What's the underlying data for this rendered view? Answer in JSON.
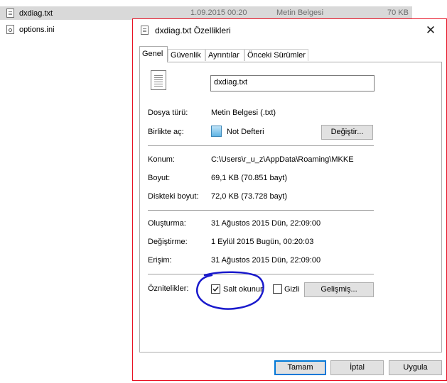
{
  "explorer": {
    "files": [
      {
        "name": "dxdiag.txt",
        "date": "1.09.2015 00:20",
        "type": "Metin Belgesi",
        "size": "70 KB",
        "icon": "text-file-icon"
      },
      {
        "name": "options.ini",
        "date": "",
        "type": "",
        "size": "",
        "icon": "settings-file-icon"
      }
    ]
  },
  "dialog": {
    "title": "dxdiag.txt Özellikleri",
    "close_label": "✕",
    "tabs": [
      "Genel",
      "Güvenlik",
      "Ayrıntılar",
      "Önceki Sürümler"
    ],
    "active_tab": "Genel",
    "file_name": "dxdiag.txt",
    "labels": {
      "file_type": "Dosya türü:",
      "opens_with": "Birlikte aç:",
      "location": "Konum:",
      "size": "Boyut:",
      "size_on_disk": "Diskteki boyut:",
      "created": "Oluşturma:",
      "modified": "Değiştirme:",
      "accessed": "Erişim:",
      "attributes": "Öznitelikler:"
    },
    "values": {
      "file_type": "Metin Belgesi (.txt)",
      "opens_with": "Not Defteri",
      "location": "C:\\Users\\r_u_z\\AppData\\Roaming\\MKKE",
      "size": "69,1 KB (70.851 bayt)",
      "size_on_disk": "72,0 KB (73.728 bayt)",
      "created": "31 Ağustos 2015 Dün, 22:09:00",
      "modified": "1 Eylül 2015 Bugün, 00:20:03",
      "accessed": "31 Ağustos 2015 Dün, 22:09:00"
    },
    "change_button": "Değiştir...",
    "attributes": {
      "readonly_label": "Salt okunur",
      "readonly_checked": true,
      "hidden_label": "Gizli",
      "hidden_checked": false,
      "advanced_button": "Gelişmiş..."
    },
    "buttons": {
      "ok": "Tamam",
      "cancel": "İptal",
      "apply": "Uygula"
    },
    "highlight_color": "#1a1acc",
    "border_color": "#e81123"
  }
}
